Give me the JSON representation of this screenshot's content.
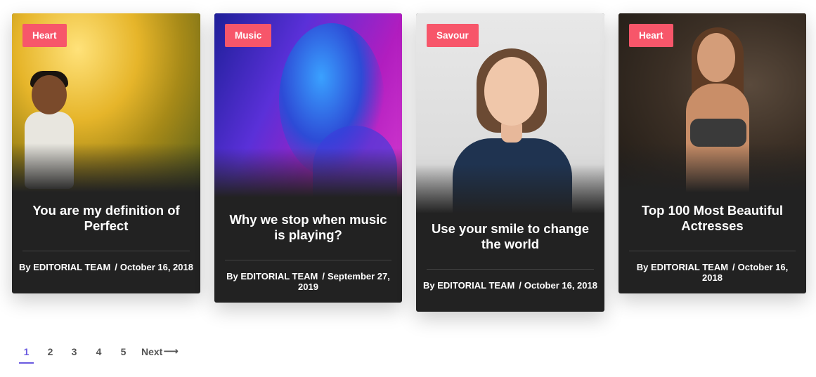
{
  "cards": [
    {
      "category": "Heart",
      "title": "You are my definition of Perfect",
      "author": "By EDITORIAL TEAM",
      "separator": "/",
      "date": "October 16, 2018"
    },
    {
      "category": "Music",
      "title": "Why we stop when music is playing?",
      "author": "By EDITORIAL TEAM",
      "separator": "/",
      "date": "September 27, 2019"
    },
    {
      "category": "Savour",
      "title": "Use your smile to change the world",
      "author": "By EDITORIAL TEAM",
      "separator": "/",
      "date": "October 16, 2018"
    },
    {
      "category": "Heart",
      "title": "Top 100 Most Beautiful Actresses",
      "author": "By EDITORIAL TEAM",
      "separator": "/",
      "date": "October 16, 2018"
    }
  ],
  "pagination": {
    "pages": [
      "1",
      "2",
      "3",
      "4",
      "5"
    ],
    "active": "1",
    "next_label": "Next",
    "next_icon": "arrow-right-icon"
  },
  "colors": {
    "badge": "#f7566a",
    "card_bg": "#222222",
    "pagination_active": "#6a5ae0"
  }
}
